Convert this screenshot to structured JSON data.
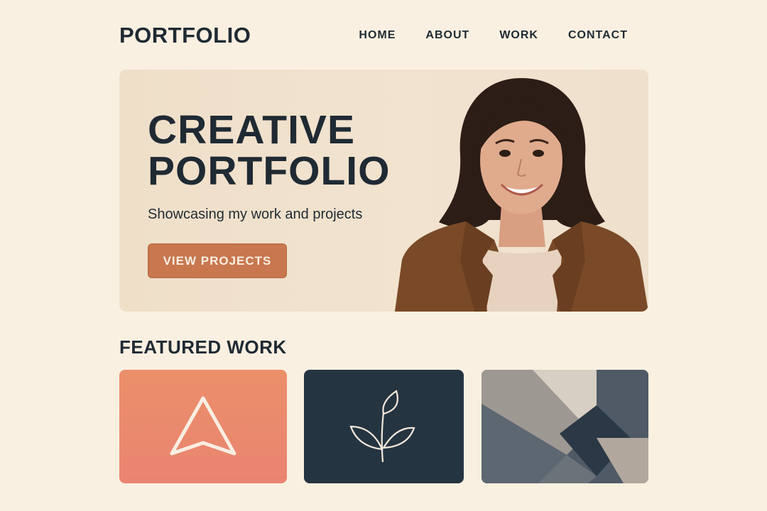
{
  "header": {
    "logo": "PORTFOLIO",
    "nav": [
      {
        "label": "HOME"
      },
      {
        "label": "ABOUT"
      },
      {
        "label": "WORK"
      },
      {
        "label": "CONTACT"
      }
    ]
  },
  "hero": {
    "title_line1": "CREATIVE",
    "title_line2": "PORTFOLIO",
    "subtitle": "Showcasing my work and projects",
    "cta_label": "VIEW PROJECTS"
  },
  "featured": {
    "title": "FEATURED WORK",
    "cards": [
      {
        "icon": "triangle-arrow-icon",
        "color": "#eb8a6c"
      },
      {
        "icon": "leaf-sprout-icon",
        "color": "#253441"
      },
      {
        "icon": "geometric-pattern",
        "color": "#4f5a66"
      }
    ]
  },
  "colors": {
    "background": "#faf0e1",
    "hero_bg": "#efdfc9",
    "accent": "#c8774f",
    "text": "#1f2a33"
  }
}
